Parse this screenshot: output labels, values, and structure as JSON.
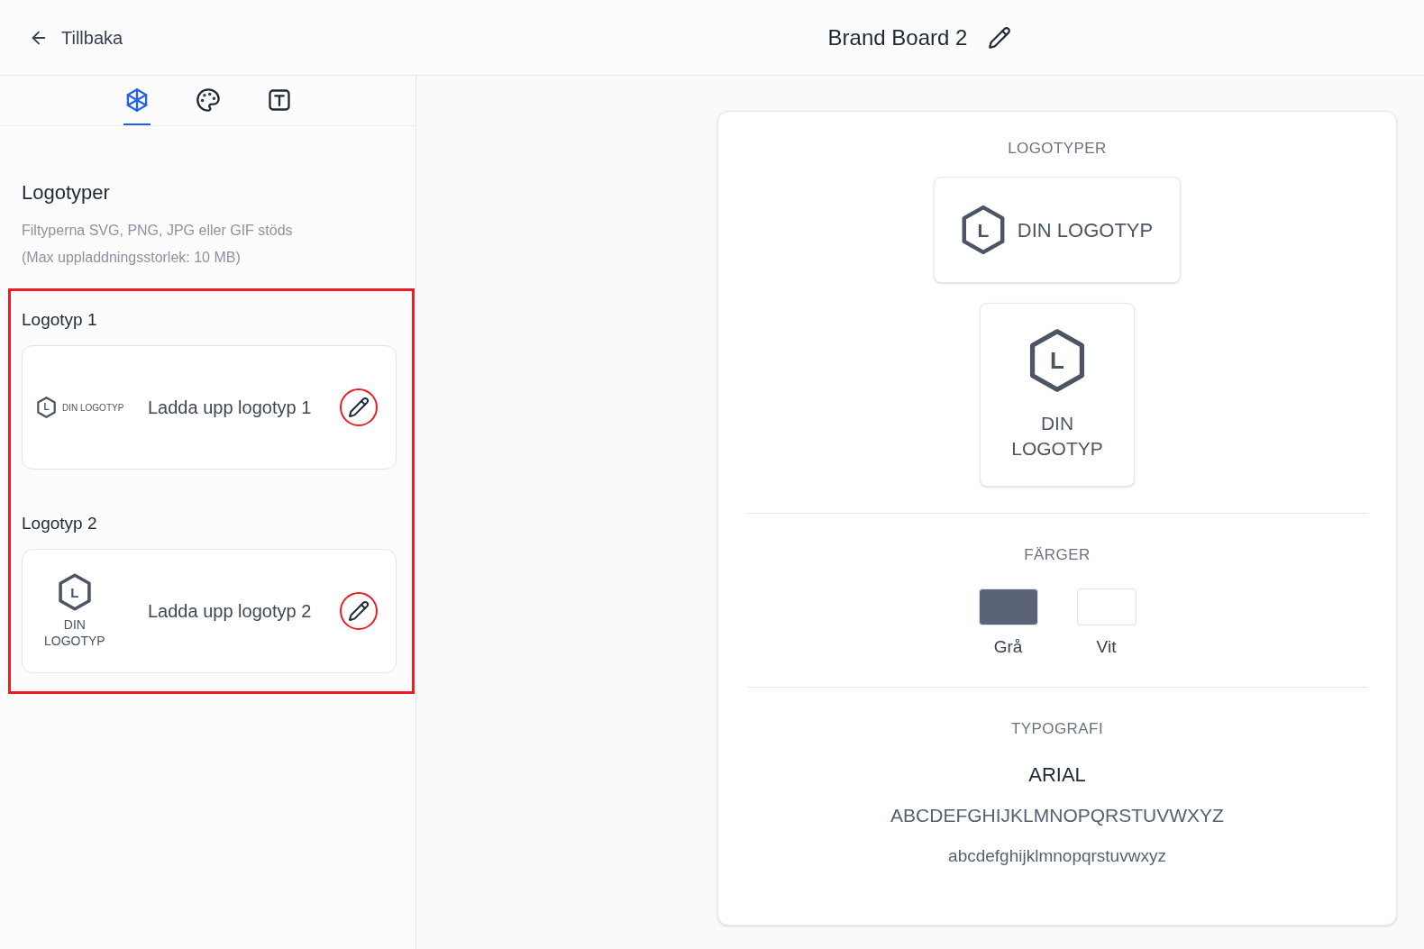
{
  "header": {
    "back_label": "Tillbaka",
    "title": "Brand Board 2"
  },
  "sidebar": {
    "tabs": [
      {
        "kind": "cube",
        "selected": true
      },
      {
        "kind": "palette",
        "selected": false
      },
      {
        "kind": "text",
        "selected": false
      }
    ],
    "section": {
      "title": "Logotyper",
      "description": [
        "Filtyperna SVG, PNG, JPG eller GIF stöds",
        "(Max uppladdningsstorlek: 10 MB)"
      ]
    },
    "logo_slots": {
      "highlighted": true,
      "items": [
        {
          "label": "Logotyp 1",
          "logo": {
            "kind": "horizontal",
            "mark": "L",
            "text": "DIN LOGOTYP"
          },
          "upload_label": "Ladda upp logotyp 1",
          "highlighted": true
        },
        {
          "label": "Logotyp 2",
          "logo": {
            "kind": "vertical",
            "mark": "L",
            "text": "DIN LOGOTYP"
          },
          "upload_label": "Ladda upp logotyp 2",
          "highlighted": true
        }
      ]
    }
  },
  "preview": {
    "logos": {
      "heading": "LOGOTYPER",
      "items": [
        {
          "kind": "horizontal",
          "mark": "L",
          "text": "DIN LOGOTYP"
        },
        {
          "kind": "vertical",
          "mark": "L",
          "text": "DIN LOGOTYP"
        }
      ]
    },
    "colors": {
      "heading": "FÄRGER",
      "items": [
        {
          "name": "Grå",
          "color": "#5b6477"
        },
        {
          "name": "Vit",
          "color": "#ffffff"
        }
      ]
    },
    "typography": {
      "heading": "TYPOGRAFI",
      "font_name": "ARIAL",
      "uppercase": "ABCDEFGHIJKLMNOPQRSTUVWXYZ",
      "lowercase": "abcdefghijklmnopqrstuvwxyz"
    }
  }
}
